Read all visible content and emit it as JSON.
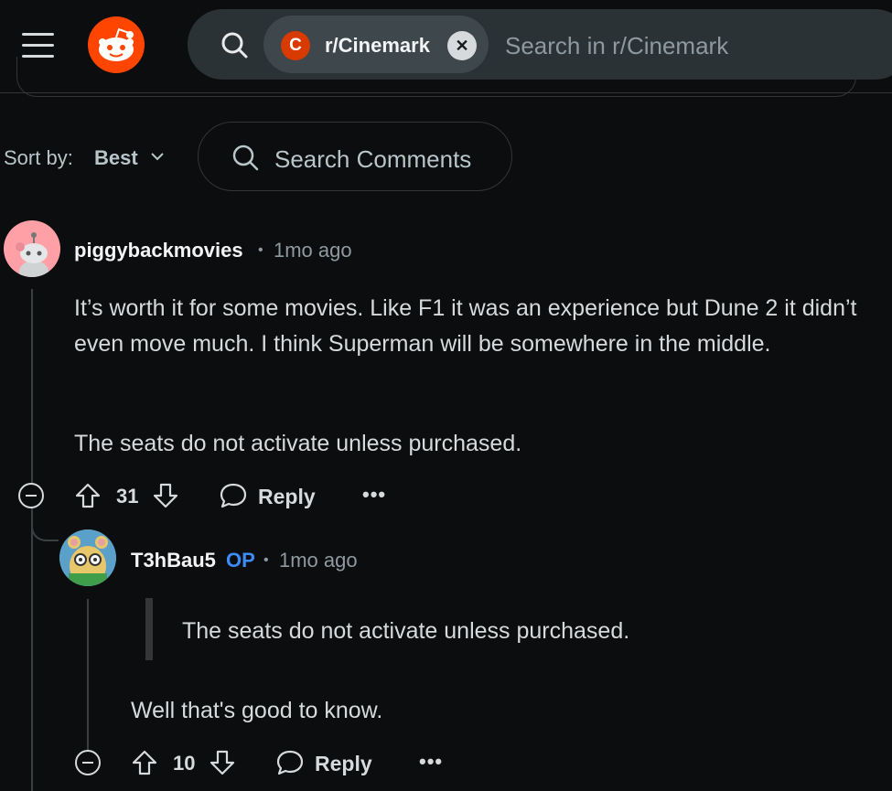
{
  "header": {
    "subreddit_chip": "r/Cinemark",
    "subreddit_initial": "C",
    "search_placeholder": "Search in r/Cinemark",
    "icons": [
      "menu-icon",
      "reddit-logo",
      "search-icon",
      "close-icon"
    ]
  },
  "sort": {
    "label": "Sort by:",
    "value": "Best",
    "comment_search_placeholder": "Search Comments"
  },
  "comments": [
    {
      "username": "piggybackmovies",
      "separator": "•",
      "time": "1mo ago",
      "paragraphs": [
        "It’s worth it for some movies. Like F1 it was an experience but Dune 2 it didn’t even move much. I think Superman will be somewhere in the middle.",
        "The seats do not activate unless purchased."
      ],
      "votes": "31",
      "reply_label": "Reply",
      "more_label": "•••"
    },
    {
      "username": "T3hBau5",
      "op_badge": "OP",
      "separator": "•",
      "time": "1mo ago",
      "quote": "The seats do not activate unless purchased.",
      "paragraphs": [
        "Well that's good to know."
      ],
      "votes": "10",
      "reply_label": "Reply",
      "more_label": "•••"
    }
  ],
  "colors": {
    "background": "#0b0d0e",
    "brand": "#ff4500",
    "op": "#3d8cf5"
  }
}
